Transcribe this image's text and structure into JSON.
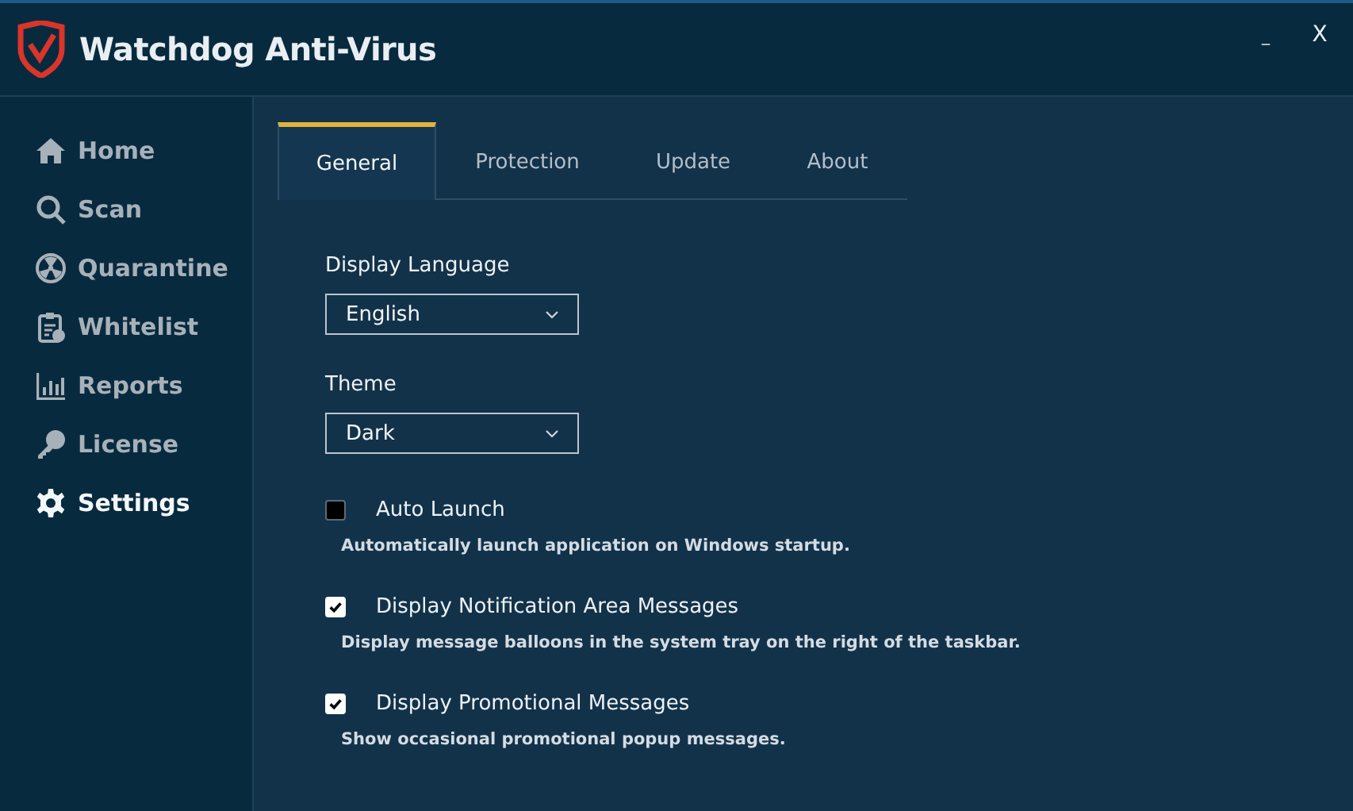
{
  "window": {
    "title": "Watchdog Anti-Virus",
    "minimize": "_",
    "close": "X"
  },
  "sidebar": {
    "items": [
      {
        "label": "Home",
        "selected": false
      },
      {
        "label": "Scan",
        "selected": false
      },
      {
        "label": "Quarantine",
        "selected": false
      },
      {
        "label": "Whitelist",
        "selected": false
      },
      {
        "label": "Reports",
        "selected": false
      },
      {
        "label": "License",
        "selected": false
      },
      {
        "label": "Settings",
        "selected": true
      }
    ]
  },
  "tabs": [
    {
      "label": "General",
      "selected": true
    },
    {
      "label": "Protection",
      "selected": false
    },
    {
      "label": "Update",
      "selected": false
    },
    {
      "label": "About",
      "selected": false
    }
  ],
  "dropdowns": [
    {
      "label": "Display Language",
      "value": "English"
    },
    {
      "label": "Theme",
      "value": "Dark"
    }
  ],
  "options": [
    {
      "label": "Auto Launch",
      "checked": false,
      "description": "Automatically launch application on Windows startup."
    },
    {
      "label": "Display Notification Area Messages",
      "checked": true,
      "description": "Display message balloons in the system tray on the right of the taskbar."
    },
    {
      "label": "Display Promotional Messages",
      "checked": true,
      "description": "Show occasional promotional popup messages."
    }
  ]
}
